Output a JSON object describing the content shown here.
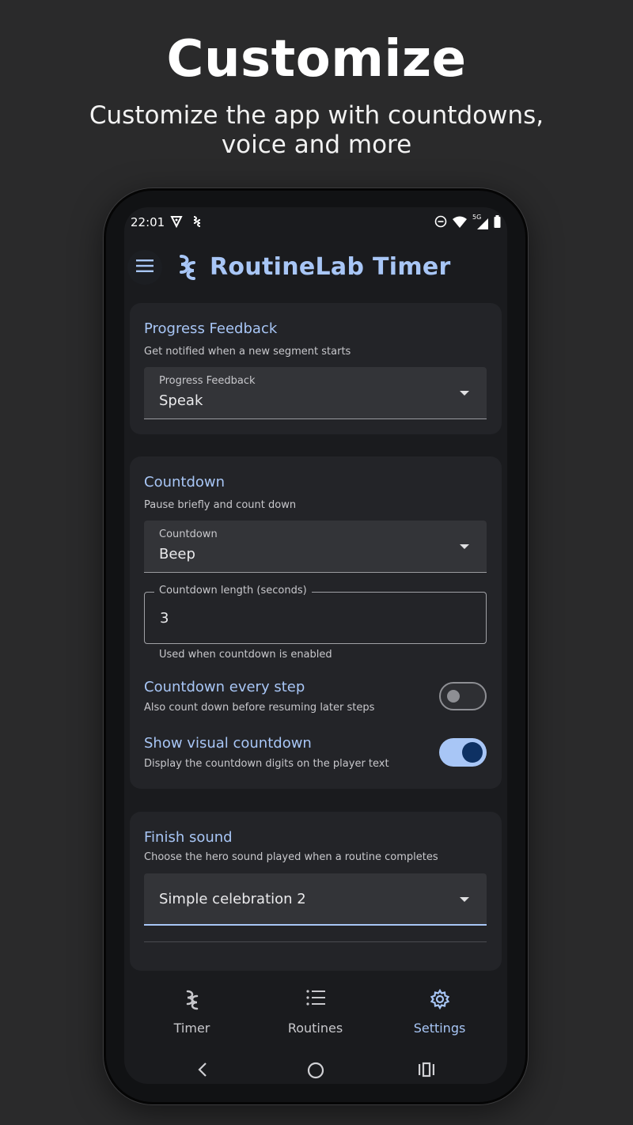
{
  "promo": {
    "headline": "Customize",
    "subline_1": "Customize the app with countdowns,",
    "subline_2": "voice and more"
  },
  "status_bar": {
    "time": "22:01",
    "icons": [
      "shield-icon",
      "app-icon",
      "dnd-icon",
      "wifi-icon",
      "5g-signal-icon",
      "battery-icon"
    ],
    "network_label": "5G"
  },
  "app_bar": {
    "title": "RoutineLab Timer",
    "menu_icon": "hamburger-menu-icon"
  },
  "progress_card": {
    "title": "Progress Feedback",
    "subtitle": "Get notified when a new segment starts",
    "select": {
      "label": "Progress Feedback",
      "value": "Speak"
    }
  },
  "countdown_card": {
    "title": "Countdown",
    "subtitle": "Pause briefly and count down",
    "select": {
      "label": "Countdown",
      "value": "Beep"
    },
    "length_field": {
      "label": "Countdown length (seconds)",
      "value": "3",
      "helper": "Used when countdown is enabled"
    },
    "every_step": {
      "title": "Countdown every step",
      "subtitle": "Also count down before resuming later steps",
      "enabled": false
    },
    "visual": {
      "title": "Show visual countdown",
      "subtitle": "Display the countdown digits on the player text",
      "enabled": true
    }
  },
  "finish_card": {
    "title": "Finish sound",
    "subtitle": "Choose the hero sound played when a routine completes",
    "select": {
      "value": "Simple celebration 2"
    }
  },
  "bottom_nav": {
    "items": [
      {
        "label": "Timer",
        "icon": "timer-logo-icon",
        "selected": false
      },
      {
        "label": "Routines",
        "icon": "list-icon",
        "selected": false
      },
      {
        "label": "Settings",
        "icon": "gear-icon",
        "selected": true
      }
    ]
  },
  "colors": {
    "accent": "#a8c6f6",
    "background": "#2a2a2b",
    "screen": "#1a1b1e",
    "card": "#232428"
  }
}
